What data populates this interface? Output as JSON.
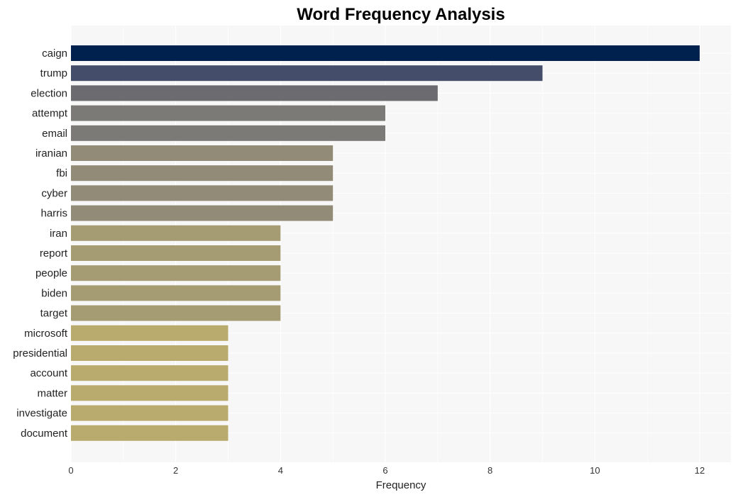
{
  "chart_data": {
    "type": "bar",
    "orientation": "horizontal",
    "title": "Word Frequency Analysis",
    "xlabel": "Frequency",
    "ylabel": "",
    "xlim": [
      0,
      12.6
    ],
    "xticks": [
      0,
      2,
      4,
      6,
      8,
      10,
      12
    ],
    "grid": true,
    "legend": "none",
    "categories": [
      "caign",
      "trump",
      "election",
      "attempt",
      "email",
      "iranian",
      "fbi",
      "cyber",
      "harris",
      "iran",
      "report",
      "people",
      "biden",
      "target",
      "microsoft",
      "presidential",
      "account",
      "matter",
      "investigate",
      "document"
    ],
    "values": [
      12,
      9,
      7,
      6,
      6,
      5,
      5,
      5,
      5,
      4,
      4,
      4,
      4,
      4,
      3,
      3,
      3,
      3,
      3,
      3
    ],
    "colors": [
      "#00214e",
      "#444e6b",
      "#6b6b70",
      "#7b7a76",
      "#7b7a76",
      "#928b77",
      "#928b77",
      "#928b77",
      "#928b77",
      "#a59c74",
      "#a59c74",
      "#a59c74",
      "#a59c74",
      "#a59c74",
      "#b9ab6d",
      "#b9ab6d",
      "#b9ab6d",
      "#b9ab6d",
      "#b9ab6d",
      "#b9ab6d"
    ],
    "background_color": "#f7f7f7",
    "grid_color": "#ffffff"
  }
}
